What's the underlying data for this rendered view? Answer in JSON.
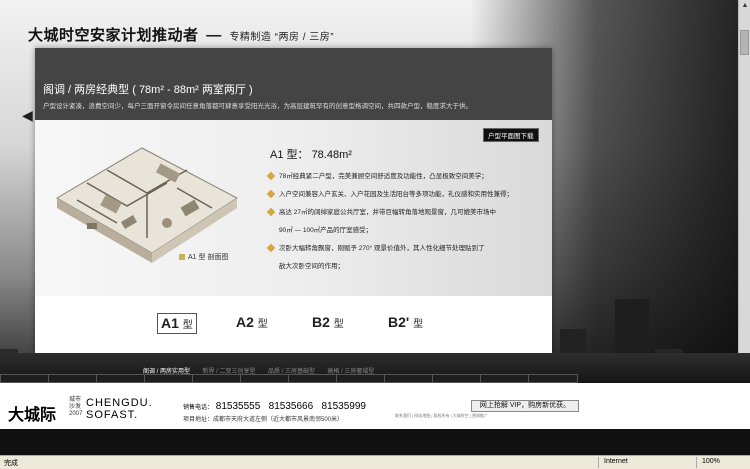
{
  "header": {
    "title": "大城时空安家计划推动者",
    "dash": "—",
    "subtitle": "专精制造 “两房 / 三房”"
  },
  "panel": {
    "title": "阁调 / 两房经典型 ( 78m² - 88m² 两室两厅 )",
    "description": "户型设计紧凑，浪费空间少，每户三面开窗令房间任意角落都可肆意享受阳光光浴，为高层建筑罕有的创意型格调空间，共四款户型，稳度求大于供。",
    "download_label": "户型平面图下载",
    "floorplan_caption": "A1 型 剖面图"
  },
  "model": {
    "title": "A1 型：  78.48m²",
    "features": [
      {
        "text": "78㎡经典紧二户型，完美兼顾空间舒适度及功能性，凸显极致空间美学；",
        "bullet": true
      },
      {
        "text": "入户空间兼容入户玄关、入户花园及生活阳台等多项功能，礼仪感和实用性兼得；",
        "bullet": true
      },
      {
        "text": "高达 27㎡的阔绰家庭公共厅室，并带巨幅转角落地观景窗，几可媲美市场中",
        "bullet": true
      },
      {
        "text": "90㎡ — 100㎡产品的厅室感受；",
        "bullet": false
      },
      {
        "text": "次卧大幅转角飘窗，刚赋予 270°  观景价值外，其人性化细节处理贴到了",
        "bullet": true
      },
      {
        "text": "敌大次卧空间的作用；",
        "bullet": false
      }
    ]
  },
  "tabs": [
    {
      "code": "A1",
      "suffix": "型",
      "active": true
    },
    {
      "code": "A2",
      "suffix": "型",
      "active": false
    },
    {
      "code": "B2",
      "suffix": "型",
      "active": false
    },
    {
      "code": "B2'",
      "suffix": "型",
      "active": false
    }
  ],
  "subnav": [
    {
      "label": "阁调 / 两房实用型",
      "active": true
    },
    {
      "label": "新界 / 二变三创享型",
      "active": false
    },
    {
      "label": "品质 / 三房基础型",
      "active": false
    },
    {
      "label": "高格 / 三房奢域型",
      "active": false
    }
  ],
  "footer": {
    "logo": "大城际",
    "logo_small": [
      "城市",
      "沙发",
      "2007"
    ],
    "brand_en_1": "CHENGDU.",
    "brand_en_2": "SOFAST.",
    "phone_label": "销售电话：",
    "phones": [
      "81535555",
      "81535666",
      "81535999"
    ],
    "address": "项目地址：成都市天府大道左侧（近大都市风景南邻500米）",
    "vip_button": "网上抢解 VIP，购房新优获。",
    "small_links": "联系我们 | 网站地图 | 版权所有 | 大城时空 | 营销推广"
  },
  "statusbar": {
    "status": "完成",
    "zone": "Internet",
    "zoom": "100%"
  },
  "colors": {
    "panel_head": "#444444",
    "bullet": "#d2a73c",
    "strip": "#1a1a1a"
  }
}
